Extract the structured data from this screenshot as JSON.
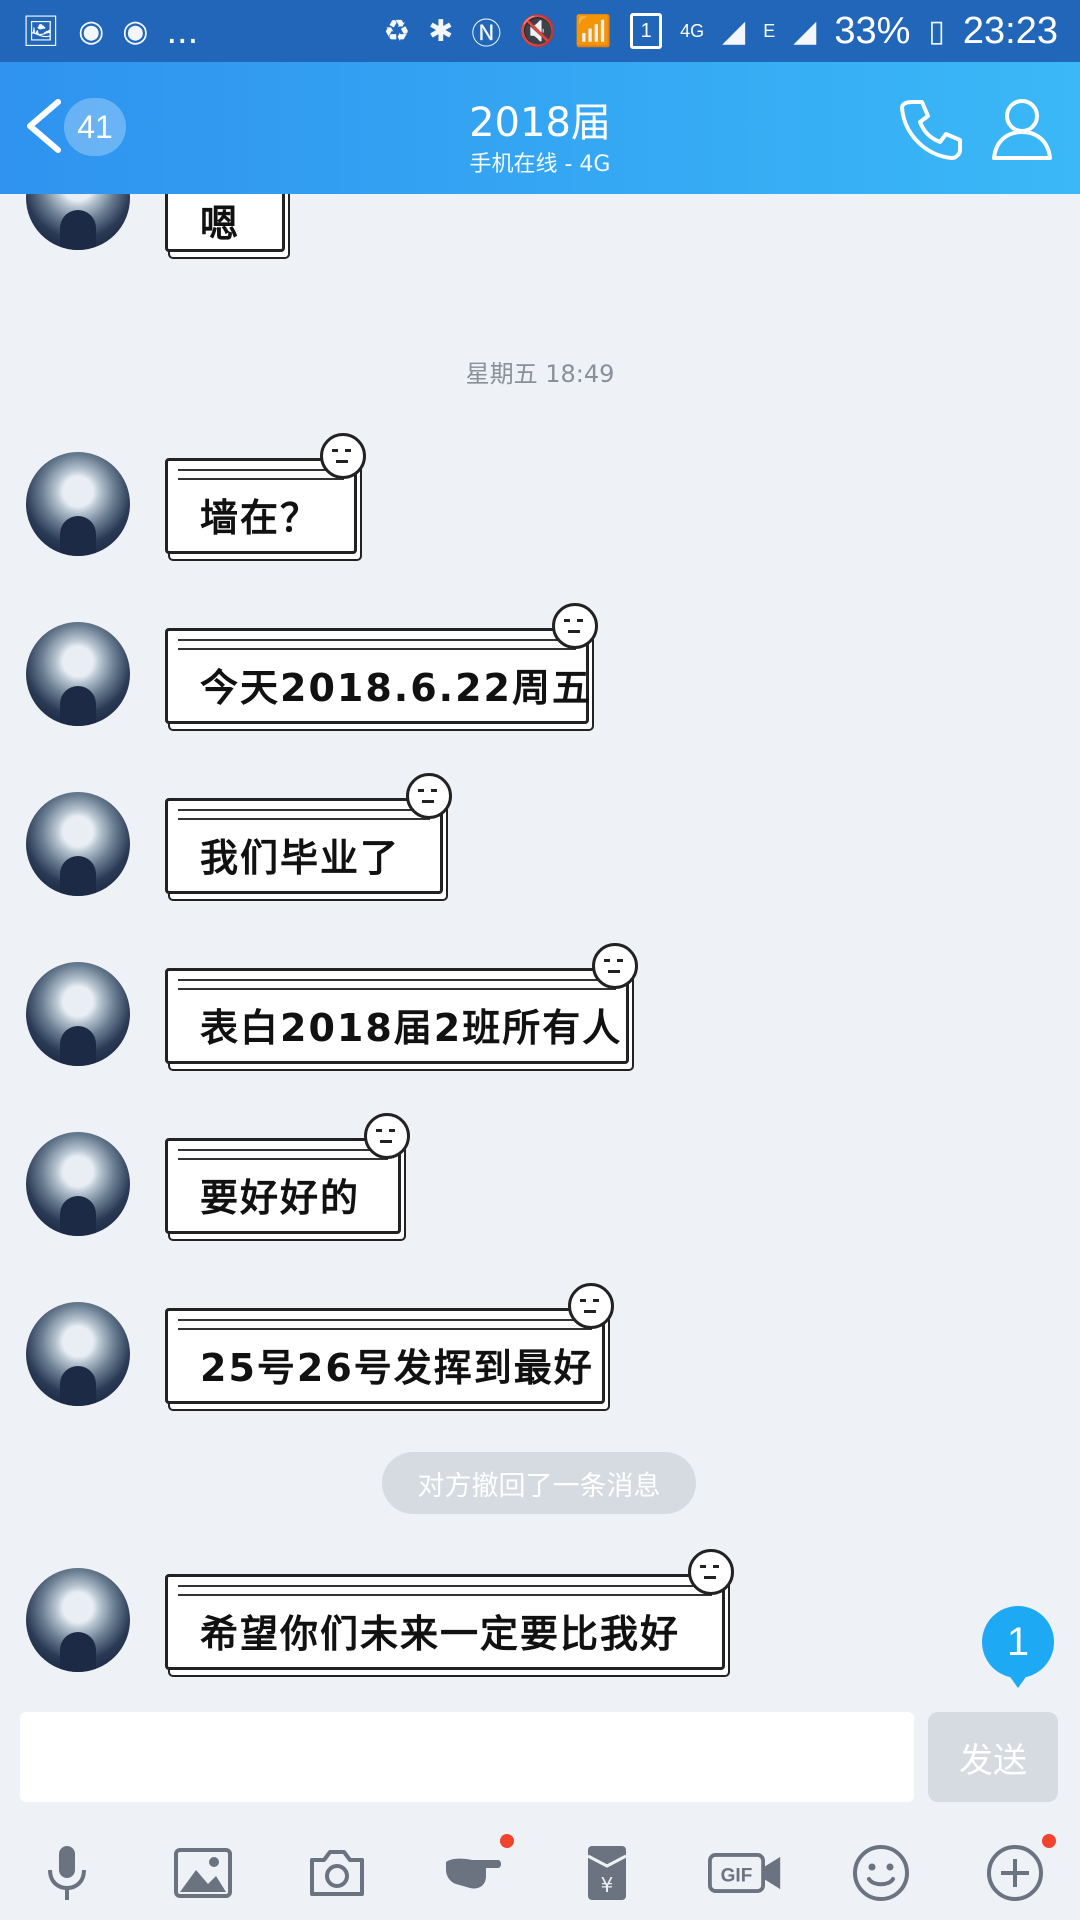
{
  "status_bar": {
    "left_icons": [
      "image-icon",
      "weibo-icon",
      "weibo-icon",
      "more-dots"
    ],
    "more": "...",
    "sim_slot": "1",
    "network_4g": "4G",
    "network_e": "E",
    "battery": "33%",
    "time": "23:23"
  },
  "header": {
    "back_count": "41",
    "title": "2018届",
    "subtitle": "手机在线 - 4G"
  },
  "partial_message": {
    "text": "嗯"
  },
  "timestamp": "星期五 18:49",
  "messages": [
    {
      "text": "墙在？"
    },
    {
      "text": "今天2018.6.22周五"
    },
    {
      "text": "我们毕业了"
    },
    {
      "text": "表白2018届2班所有人"
    },
    {
      "text": "要好好的"
    },
    {
      "text": "25号26号发挥到最好"
    },
    {
      "text": "希望你们未来一定要比我好"
    }
  ],
  "system_notice": "对方撤回了一条消息",
  "unread_badge": "1",
  "composer": {
    "input_value": "",
    "send_label": "发送"
  },
  "toolbar": {
    "items": [
      "microphone-icon",
      "image-icon",
      "camera-icon",
      "poke-icon",
      "red-packet-icon",
      "gif-icon",
      "emoji-icon",
      "plus-icon"
    ],
    "gif_label": "GIF"
  },
  "colors": {
    "status_bar": "#2166b9",
    "header_start": "#2f93ef",
    "header_end": "#3ab8f7",
    "background": "#eef1f6",
    "badge": "#1ea9f4",
    "notification_dot": "#f0442f"
  }
}
